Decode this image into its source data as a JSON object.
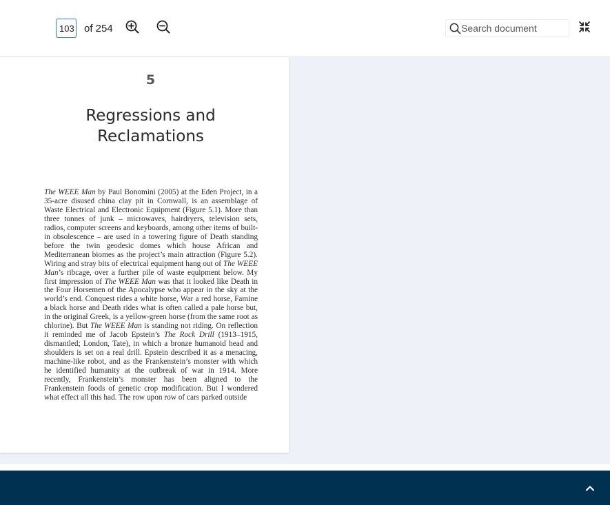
{
  "toolbar": {
    "page_input_value": "103",
    "page_count": "of 254",
    "zoom_in_icon": "zoom-in-icon",
    "zoom_out_icon": "zoom-out-icon",
    "search_placeholder": "Search document",
    "collapse_icon": "collapse-icon"
  },
  "document": {
    "chapter_number": "5",
    "chapter_title_line1": "Regressions and",
    "chapter_title_line2": "Reclamations",
    "paragraph": [
      {
        "text": "The WEEE Man",
        "italic": true
      },
      {
        "text": " by Paul Bonomini (2005) at the Eden Project, in a 35-acre disused china clay pit in Cornwall, is an assemblage of Waste Electrical and Electronic Equipment (Figure 5.1). More than three tonnes of junk – microwaves, hairdryers, television sets, radios, computer screens and keyboards, among other items of built-in obsolescence – are used in a towering figure of Death standing before the twin geodesic domes which house African and Mediterranean biomes as the project’s main attraction (Figure 5.2). Wiring and stray bits of electrical equipment hang out of ",
        "italic": false
      },
      {
        "text": "The WEEE Man",
        "italic": true
      },
      {
        "text": "’s ribcage, over a further pile of waste equipment below. My first impression of ",
        "italic": false
      },
      {
        "text": "The WEEE Man",
        "italic": true
      },
      {
        "text": " was that it looked like Death in the Four Horsemen of the Apocalypse who appear in the sky at the world’s end. Conquest rides a white horse, War a red horse, Famine a black horse and Death rides what is often called a pale horse but, in the original Greek, is a yellow-green horse (from the same root as chlorine). But ",
        "italic": false
      },
      {
        "text": "The WEEE Man",
        "italic": true
      },
      {
        "text": " is standing not riding. On reflection it reminded me of Jacob Epstein’s ",
        "italic": false
      },
      {
        "text": "The Rock Drill",
        "italic": true
      },
      {
        "text": " (1913–1915, dismantled; London, Tate), in which a bronze humanoid head and shoulders is set on a real drill. Epstein described it as a menacing, machine-like robot, and as the Frankenstein’s monster with which he identified humanity at the outbreak of war in 1914. More recently, Frankenstein’s monster has been aligned to the Frankenstein foods of genetic crop modification. But I wondered what effect all this had. The row upon row of cars parked outside",
        "italic": false
      }
    ]
  },
  "footer": {
    "scroll_top_icon": "chevron-up-icon",
    "background_color": "#003150"
  }
}
